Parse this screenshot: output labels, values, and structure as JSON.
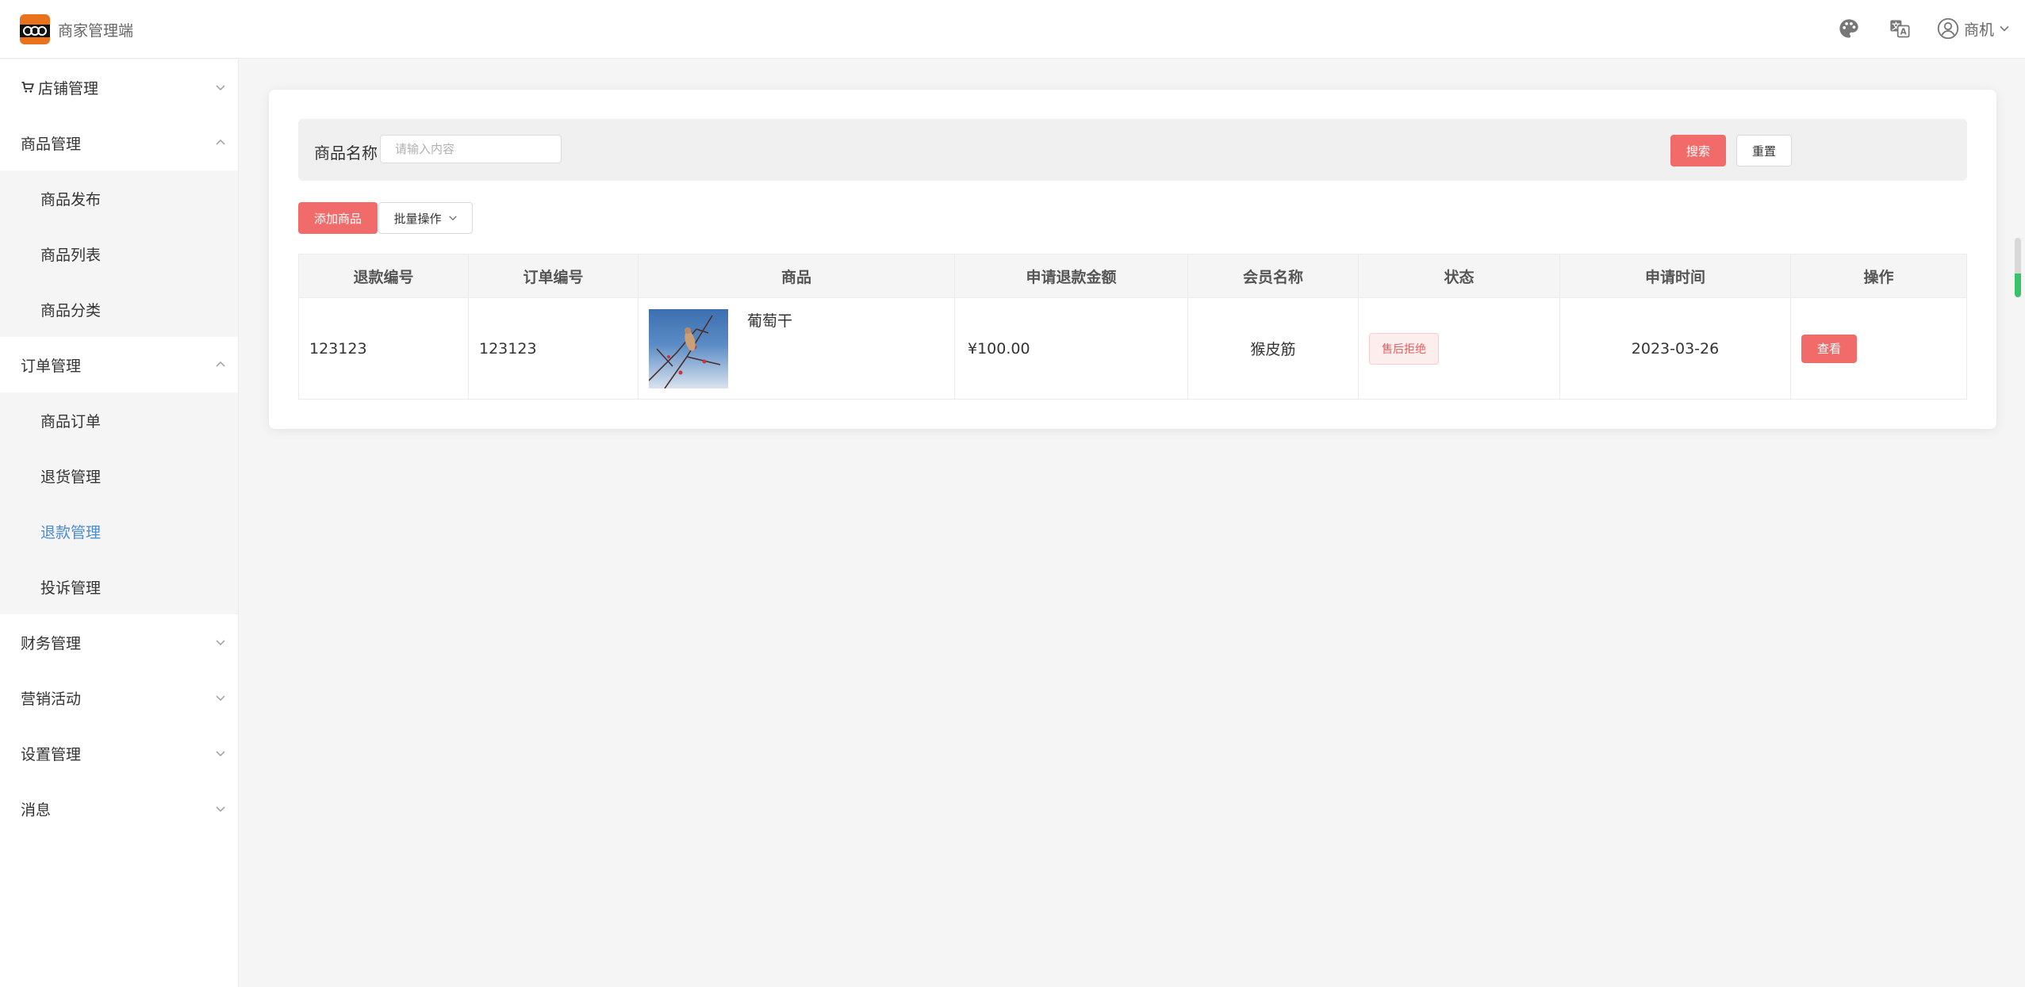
{
  "header": {
    "app_title": "商家管理端",
    "user_name": "商机"
  },
  "sidebar": {
    "shop": "店铺管理",
    "goods": "商品管理",
    "goods_publish": "商品发布",
    "goods_list": "商品列表",
    "goods_category": "商品分类",
    "orders": "订单管理",
    "goods_orders": "商品订单",
    "returns": "退货管理",
    "refunds": "退款管理",
    "complaints": "投诉管理",
    "finance": "财务管理",
    "marketing": "营销活动",
    "settings": "设置管理",
    "messages": "消息"
  },
  "search": {
    "label": "商品名称",
    "placeholder": "请输入内容",
    "search_btn": "搜索",
    "reset_btn": "重置"
  },
  "toolbar": {
    "add_btn": "添加商品",
    "batch_btn": "批量操作"
  },
  "table": {
    "headers": [
      "退款编号",
      "订单编号",
      "商品",
      "申请退款金额",
      "会员名称",
      "状态",
      "申请时间",
      "操作"
    ],
    "rows": [
      {
        "refund_no": "123123",
        "order_no": "123123",
        "goods_name": "葡萄干",
        "amount": "¥100.00",
        "member": "猴皮筋",
        "status": "售后拒绝",
        "time": "2023-03-26",
        "action": "查看"
      }
    ]
  },
  "colors": {
    "primary": "#f26b6b",
    "active_menu": "#4a8bd4"
  }
}
